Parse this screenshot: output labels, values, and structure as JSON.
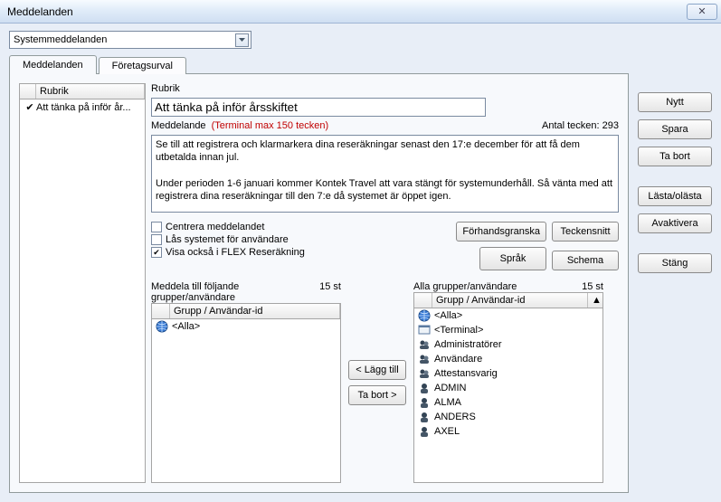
{
  "window": {
    "title": "Meddelanden",
    "close_icon": "✕"
  },
  "dropdown": {
    "selected": "Systemmeddelanden"
  },
  "tabs": {
    "meddelanden": "Meddelanden",
    "foretagsurval": "Företagsurval"
  },
  "msg_list": {
    "header_col": "Rubrik",
    "items": [
      {
        "checked": true,
        "text": "Att tänka på inför år..."
      }
    ]
  },
  "form": {
    "rubrik_label": "Rubrik",
    "rubrik_value": "Att tänka på inför årsskiftet",
    "meddelande_label": "Meddelande",
    "terminal_hint": "(Terminal max 150 tecken)",
    "char_count_label": "Antal tecken: 293",
    "body": "Se till att registrera och klarmarkera dina reseräkningar senast den 17:e december för att få dem utbetalda innan jul.\n\nUnder perioden 1-6 januari kommer Kontek Travel att vara stängt för systemunderhåll. Så vänta med att registrera dina reseräkningar till den 7:e då systemet är öppet igen.",
    "chk_centrera": "Centrera meddelandet",
    "chk_las": "Lås systemet för användare",
    "chk_visa": "Visa också i FLEX Reseräkning",
    "btn_forhandsgranska": "Förhandsgranska",
    "btn_teckensnitt": "Teckensnitt",
    "btn_sprak": "Språk",
    "btn_schema": "Schema"
  },
  "left_list": {
    "title": "Meddela till följande grupper/användare",
    "count": "15 st",
    "header_col": "Grupp / Användar-id",
    "items": [
      {
        "icon": "globe",
        "text": "<Alla>"
      }
    ]
  },
  "right_list": {
    "title": "Alla grupper/användare",
    "count": "15 st",
    "header_col": "Grupp / Användar-id",
    "items": [
      {
        "icon": "globe",
        "text": "<Alla>"
      },
      {
        "icon": "terminal",
        "text": "<Terminal>"
      },
      {
        "icon": "group",
        "text": "Administratörer"
      },
      {
        "icon": "group",
        "text": "Användare"
      },
      {
        "icon": "group",
        "text": "Attestansvarig"
      },
      {
        "icon": "user",
        "text": "ADMIN"
      },
      {
        "icon": "user",
        "text": "ALMA"
      },
      {
        "icon": "user",
        "text": "ANDERS"
      },
      {
        "icon": "user",
        "text": "AXEL"
      }
    ]
  },
  "transfer": {
    "lagg_till": "< Lägg till",
    "ta_bort": "Ta bort >"
  },
  "side_buttons": {
    "nytt": "Nytt",
    "spara": "Spara",
    "ta_bort": "Ta bort",
    "lasta_olasta": "Lästa/olästa",
    "avaktivera": "Avaktivera",
    "stang": "Stäng"
  }
}
